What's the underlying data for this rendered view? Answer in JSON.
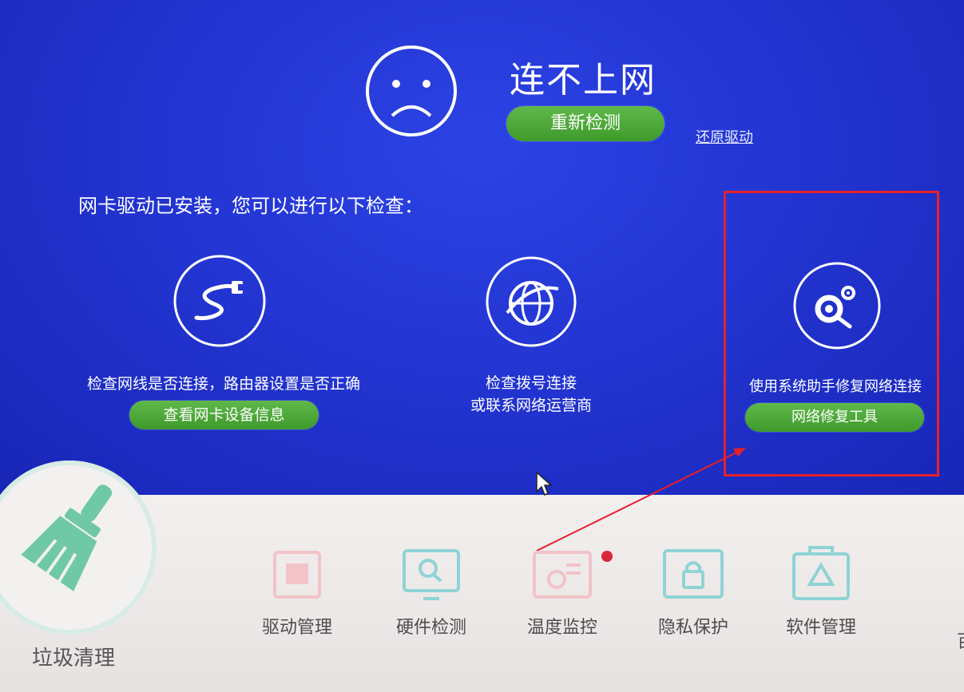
{
  "status": {
    "title": "连不上网",
    "recheck_button": "重新检测",
    "restore_link": "还原驱动"
  },
  "intro": "网卡驱动已安装，您可以进行以下检查：",
  "checks": [
    {
      "icon": "network-cable-icon",
      "text": "检查网线是否连接，路由器设置是否正确",
      "button": "查看网卡设备信息"
    },
    {
      "icon": "globe-icon",
      "text_line1": "检查拨号连接",
      "text_line2": "或联系网络运营商"
    },
    {
      "icon": "repair-gear-icon",
      "text": "使用系统助手修复网络连接",
      "button": "网络修复工具"
    }
  ],
  "toolbar": {
    "main": "垃圾清理",
    "items": [
      "驱动管理",
      "硬件检测",
      "温度监控",
      "隐私保护",
      "软件管理"
    ],
    "partial": "百"
  },
  "colors": {
    "accent_green": "#4aa836",
    "panel_blue": "#2335d2",
    "highlight_red": "#e8202a",
    "tool_pink": "#f2c3c8",
    "tool_teal": "#8fd3d5"
  }
}
